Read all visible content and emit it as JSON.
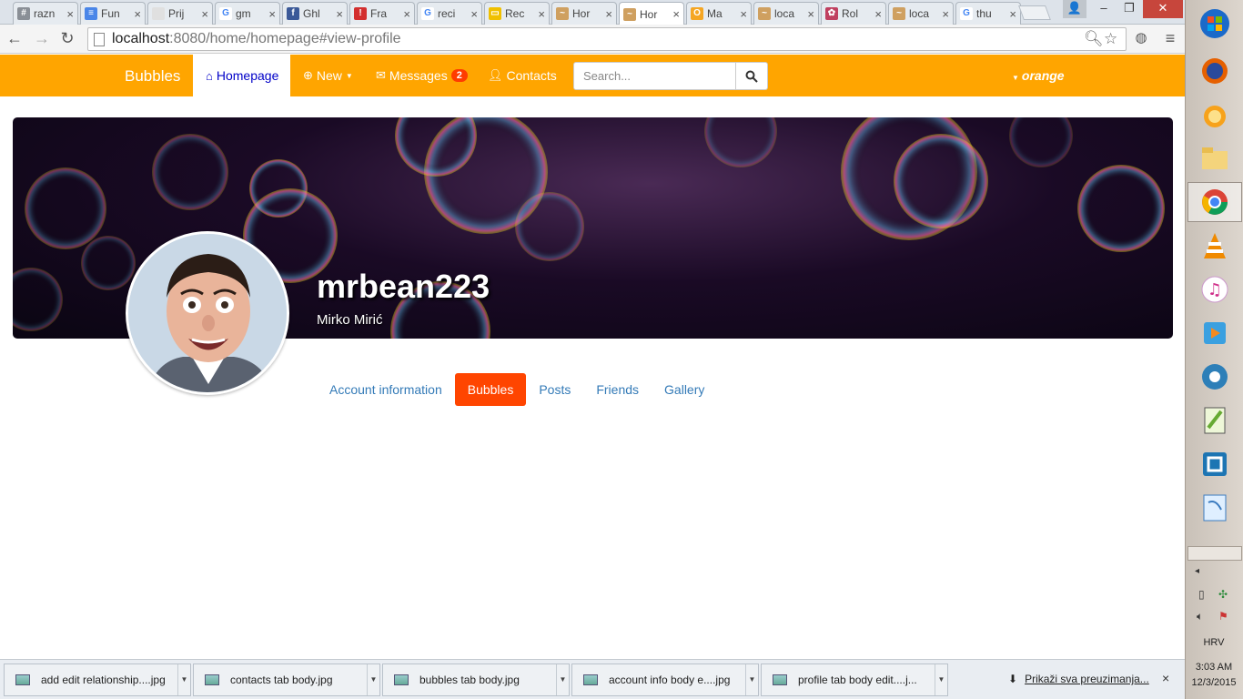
{
  "browser": {
    "tabs": [
      {
        "label": "razn",
        "fav_color": "#8a8f96",
        "fav_glyph": "#"
      },
      {
        "label": "Fun",
        "fav_color": "#4a86e8",
        "fav_glyph": "≡"
      },
      {
        "label": "Prij",
        "fav_color": "#e0e0e0",
        "fav_glyph": ""
      },
      {
        "label": "gm",
        "fav_color": "#ffffff",
        "fav_glyph": "G"
      },
      {
        "label": "Ghl",
        "fav_color": "#3b5998",
        "fav_glyph": "f"
      },
      {
        "label": "Fra",
        "fav_color": "#d32f2f",
        "fav_glyph": "!"
      },
      {
        "label": "reci",
        "fav_color": "#ffffff",
        "fav_glyph": "G"
      },
      {
        "label": "Rec",
        "fav_color": "#f0c000",
        "fav_glyph": "▭"
      },
      {
        "label": "Hor",
        "fav_color": "#cfa060",
        "fav_glyph": "~"
      },
      {
        "label": "Hor",
        "fav_color": "#cfa060",
        "fav_glyph": "~",
        "active": true
      },
      {
        "label": "Ma",
        "fav_color": "#f5a623",
        "fav_glyph": "O"
      },
      {
        "label": "loca",
        "fav_color": "#cfa060",
        "fav_glyph": "~"
      },
      {
        "label": "Rol",
        "fav_color": "#c04060",
        "fav_glyph": "✿"
      },
      {
        "label": "loca",
        "fav_color": "#cfa060",
        "fav_glyph": "~"
      },
      {
        "label": "thu",
        "fav_color": "#ffffff",
        "fav_glyph": "G"
      }
    ],
    "close_glyph": "×",
    "url_host": "localhost",
    "url_rest": ":8080/home/homepage#view-profile"
  },
  "app": {
    "brand": "Bubbles",
    "nav": {
      "homepage": "Homepage",
      "new": "New",
      "messages": "Messages",
      "messages_count": "2",
      "contacts": "Contacts"
    },
    "search_placeholder": "Search...",
    "user": "orange"
  },
  "profile": {
    "username": "mrbean223",
    "full_name": "Mirko Mirić",
    "tabs": [
      "Account information",
      "Bubbles",
      "Posts",
      "Friends",
      "Gallery"
    ],
    "active_tab": "Bubbles"
  },
  "downloads": {
    "items": [
      "add edit relationship....jpg",
      "contacts tab body.jpg",
      "bubbles tab body.jpg",
      "account info body e....jpg",
      "profile tab  body edit....j..."
    ],
    "show_all": "Prikaži sva preuzimanja...",
    "close": "×"
  },
  "system_tray": {
    "language": "HRV",
    "time": "3:03 AM",
    "date": "12/3/2015"
  },
  "colors": {
    "navbar": "#ffa500",
    "active_profile_tab": "#ff4500",
    "badge": "#ff3c00",
    "link": "#337ab7"
  }
}
